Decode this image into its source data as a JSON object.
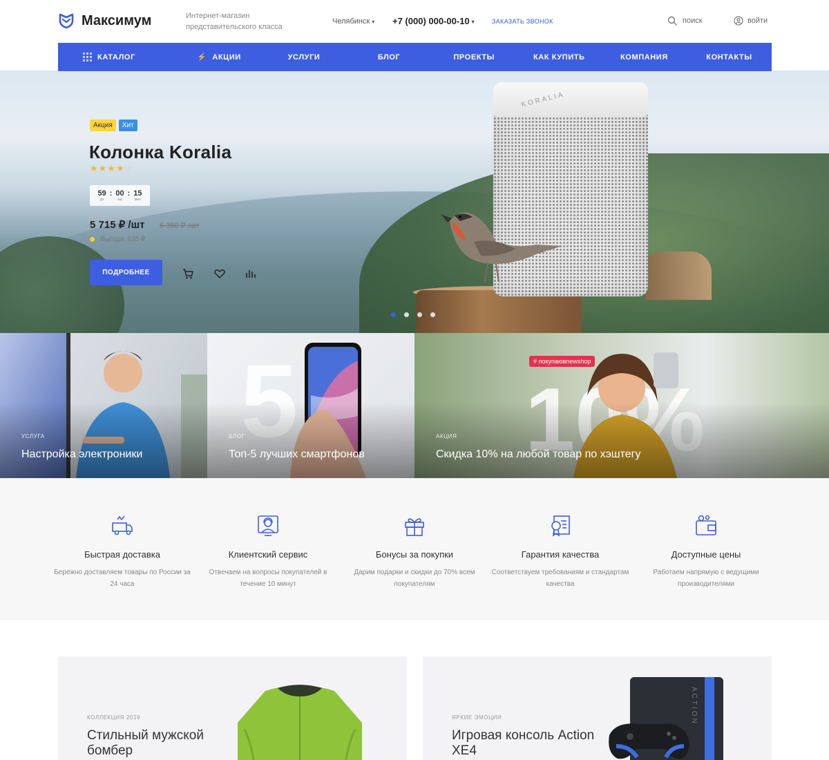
{
  "header": {
    "logo_text": "Максимум",
    "tagline": "Интернет-магазин представительского класса",
    "city": "Челябинск",
    "phone": "+7 (000) 000-00-10",
    "callback": "заказать звонок",
    "search_label": "поиск",
    "login_label": "войти"
  },
  "nav": {
    "items": [
      {
        "label": "Каталог"
      },
      {
        "label": "Акции"
      },
      {
        "label": "Услуги"
      },
      {
        "label": "Блог"
      },
      {
        "label": "Проекты"
      },
      {
        "label": "Как купить"
      },
      {
        "label": "Компания"
      },
      {
        "label": "Контакты"
      }
    ]
  },
  "hero": {
    "badges": [
      "Акция",
      "Хит"
    ],
    "title": "Колонка Koralia",
    "rating": 4,
    "rating_max": 5,
    "timer": {
      "days": "59",
      "days_label": "дн",
      "hours": "00",
      "hours_label": "час",
      "minutes": "15",
      "minutes_label": "мин"
    },
    "price": "5 715 ₽ /шт",
    "old_price": "6 350 ₽ /шт",
    "saving": "Выгода: 635 ₽",
    "button_label": "Подробнее",
    "product_brand": "KORALIA",
    "slides_total": 4,
    "slide_active": 1
  },
  "promos": [
    {
      "category": "Услуга",
      "title": "Настройка электроники"
    },
    {
      "category": "Блог",
      "title": "Топ-5 лучших смартфонов"
    },
    {
      "category": "Акция",
      "title": "Скидка 10% на любой товар по хэштегу",
      "hashtag": "покупаювnewshop"
    }
  ],
  "features": [
    {
      "icon": "delivery-truck-icon",
      "title": "Быстрая доставка",
      "desc": "Бережно доставляем товары по России за 24 часа"
    },
    {
      "icon": "support-agent-icon",
      "title": "Клиентский сервис",
      "desc": "Отвечаем на вопросы покупателей в течение 10 минут"
    },
    {
      "icon": "gift-icon",
      "title": "Бонусы за покупки",
      "desc": "Дарим подарки и скидки до 70% всем покупателям"
    },
    {
      "icon": "certificate-icon",
      "title": "Гарантия качества",
      "desc": "Соответствуем требованиям и стандартам качества"
    },
    {
      "icon": "wallet-icon",
      "title": "Доступные цены",
      "desc": "Работаем напрямую с ведущими производителями"
    }
  ],
  "cards": [
    {
      "category": "Коллекция 2019",
      "title": "Стильный мужской бомбер"
    },
    {
      "category": "Яркие эмоции",
      "title": "Игровая консоль Action XE4",
      "brand": "ACTION"
    }
  ],
  "colors": {
    "accent": "#3d5ee1",
    "badge_sale": "#ffd43a",
    "badge_hit": "#3b8fe8",
    "star": "#f2b830"
  }
}
